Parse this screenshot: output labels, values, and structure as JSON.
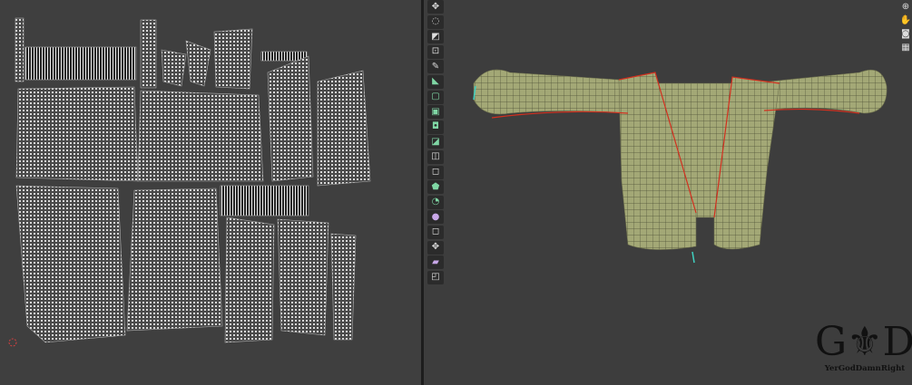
{
  "uv_editor": {
    "islands": "uv-mesh-islands",
    "cursor": "2d-cursor-icon"
  },
  "viewport": {
    "toolbar": [
      "move-icon",
      "rotate-icon",
      "scale-icon",
      "transform-icon",
      "annotate-icon",
      "measure-icon",
      "add-cube-icon",
      "extrude-region-icon",
      "inset-faces-icon",
      "bevel-icon",
      "loop-cut-icon",
      "knife-icon",
      "poly-build-icon",
      "spin-icon",
      "smooth-icon",
      "edge-slide-icon",
      "shrink-fatten-icon",
      "shear-icon",
      "rip-region-icon"
    ],
    "nav_gizmo": [
      "zoom-icon",
      "pan-hand-icon",
      "camera-icon",
      "grid-icon"
    ],
    "mesh_color": "#a3a876",
    "seam_color": "#d2301f"
  },
  "watermark": {
    "logo": "G⚜D",
    "tagline": "YerGodDamnRight"
  }
}
